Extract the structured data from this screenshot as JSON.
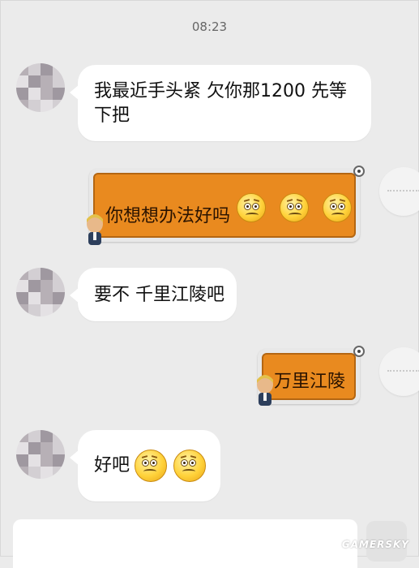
{
  "header": {
    "time": "08:23"
  },
  "messages": [
    {
      "side": "left",
      "text": "我最近手头紧  欠你那1200 先等下把",
      "line1": "我最近手头紧  欠你那1200 先等",
      "line2": "下把"
    },
    {
      "side": "right",
      "text": "你想想办法好吗",
      "emoji_count": 3,
      "emoji": "worried-face-icon"
    },
    {
      "side": "left",
      "text": "要不 千里江陵吧"
    },
    {
      "side": "right",
      "text": "万里江陵"
    },
    {
      "side": "left",
      "text": "好吧",
      "emoji_count": 2,
      "emoji": "worried-face-icon"
    }
  ],
  "watermark": "GAMERSKY",
  "colors": {
    "background": "#ebebeb",
    "left_bubble": "#ffffff",
    "right_card": "#e98a1f"
  }
}
